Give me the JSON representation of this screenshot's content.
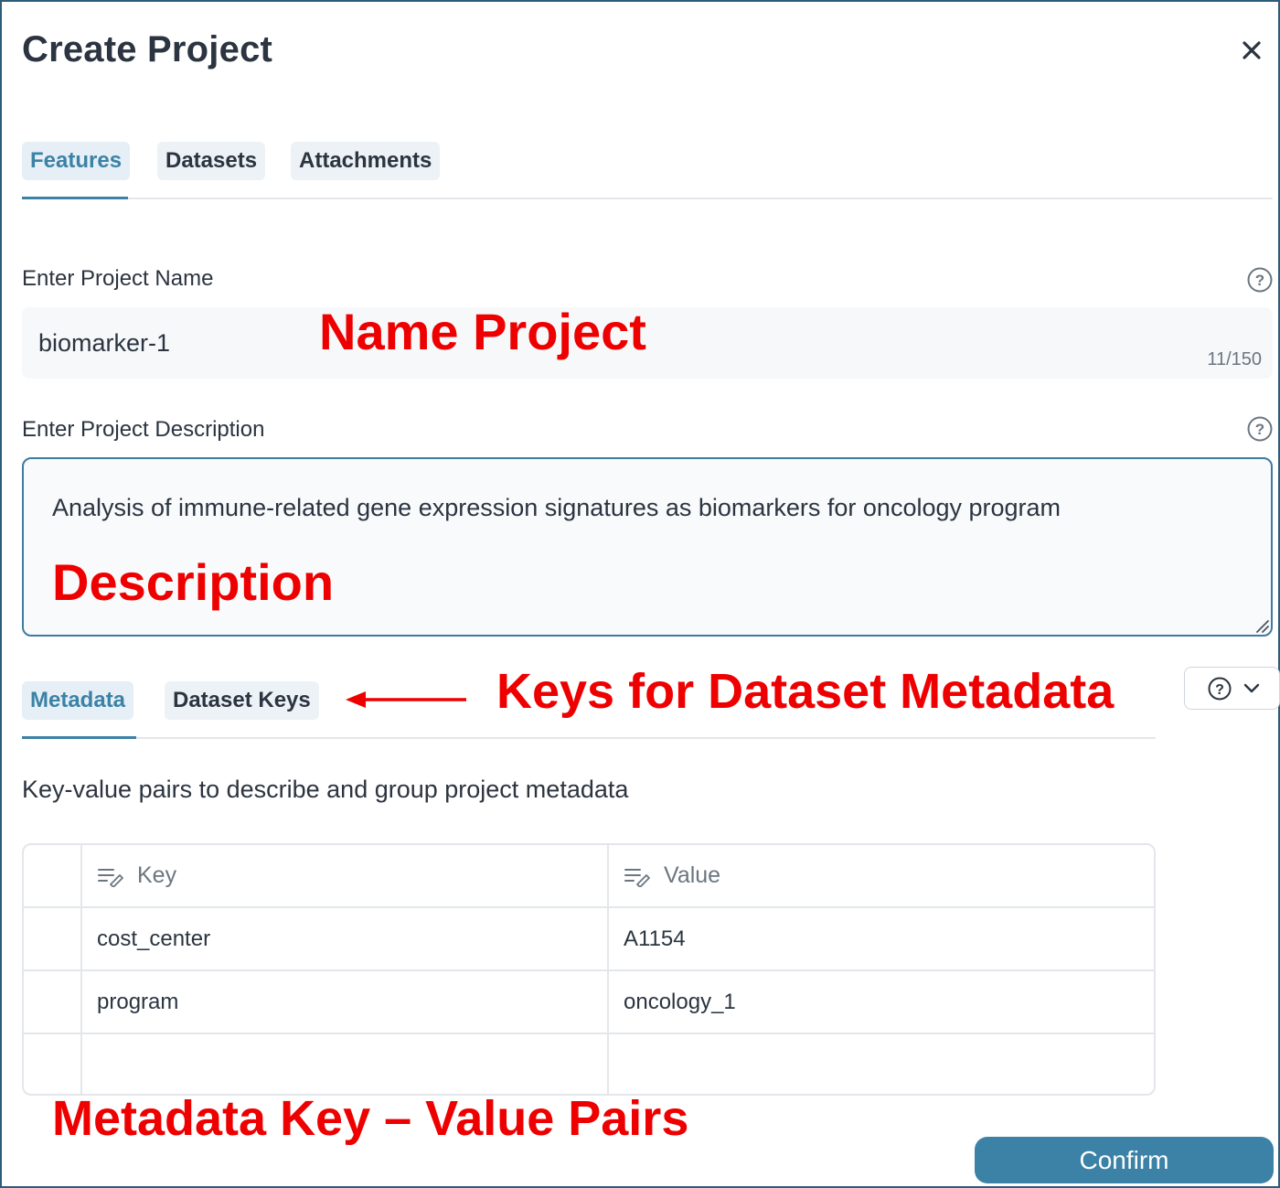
{
  "dialog": {
    "title": "Create Project",
    "close_icon": "close-icon"
  },
  "tabs": [
    {
      "label": "Features",
      "active": true
    },
    {
      "label": "Datasets",
      "active": false
    },
    {
      "label": "Attachments",
      "active": false
    }
  ],
  "project_name": {
    "label": "Enter Project Name",
    "value": "biomarker-1",
    "char_count": "11/150",
    "help_icon": "help-circle-icon"
  },
  "project_description": {
    "label": "Enter Project Description",
    "value": "Analysis of immune-related gene expression signatures as biomarkers for oncology program",
    "help_icon": "help-circle-icon"
  },
  "subtabs": [
    {
      "label": "Metadata",
      "active": true
    },
    {
      "label": "Dataset Keys",
      "active": false
    }
  ],
  "metadata": {
    "description": "Key-value pairs to describe and group project metadata",
    "headers": {
      "key": "Key",
      "value": "Value"
    },
    "rows": [
      {
        "key": "cost_center",
        "value": "A1154"
      },
      {
        "key": "program",
        "value": "oncology_1"
      },
      {
        "key": "",
        "value": ""
      }
    ]
  },
  "annotations": {
    "name_project": "Name Project",
    "description": "Description",
    "keys_for_dataset_metadata": "Keys for Dataset Metadata",
    "metadata_pairs": "Metadata Key – Value Pairs"
  },
  "confirm_label": "Confirm",
  "colors": {
    "accent": "#3b82a6",
    "annotation": "#ee0000",
    "dialog_border": "#2e5d7a"
  }
}
